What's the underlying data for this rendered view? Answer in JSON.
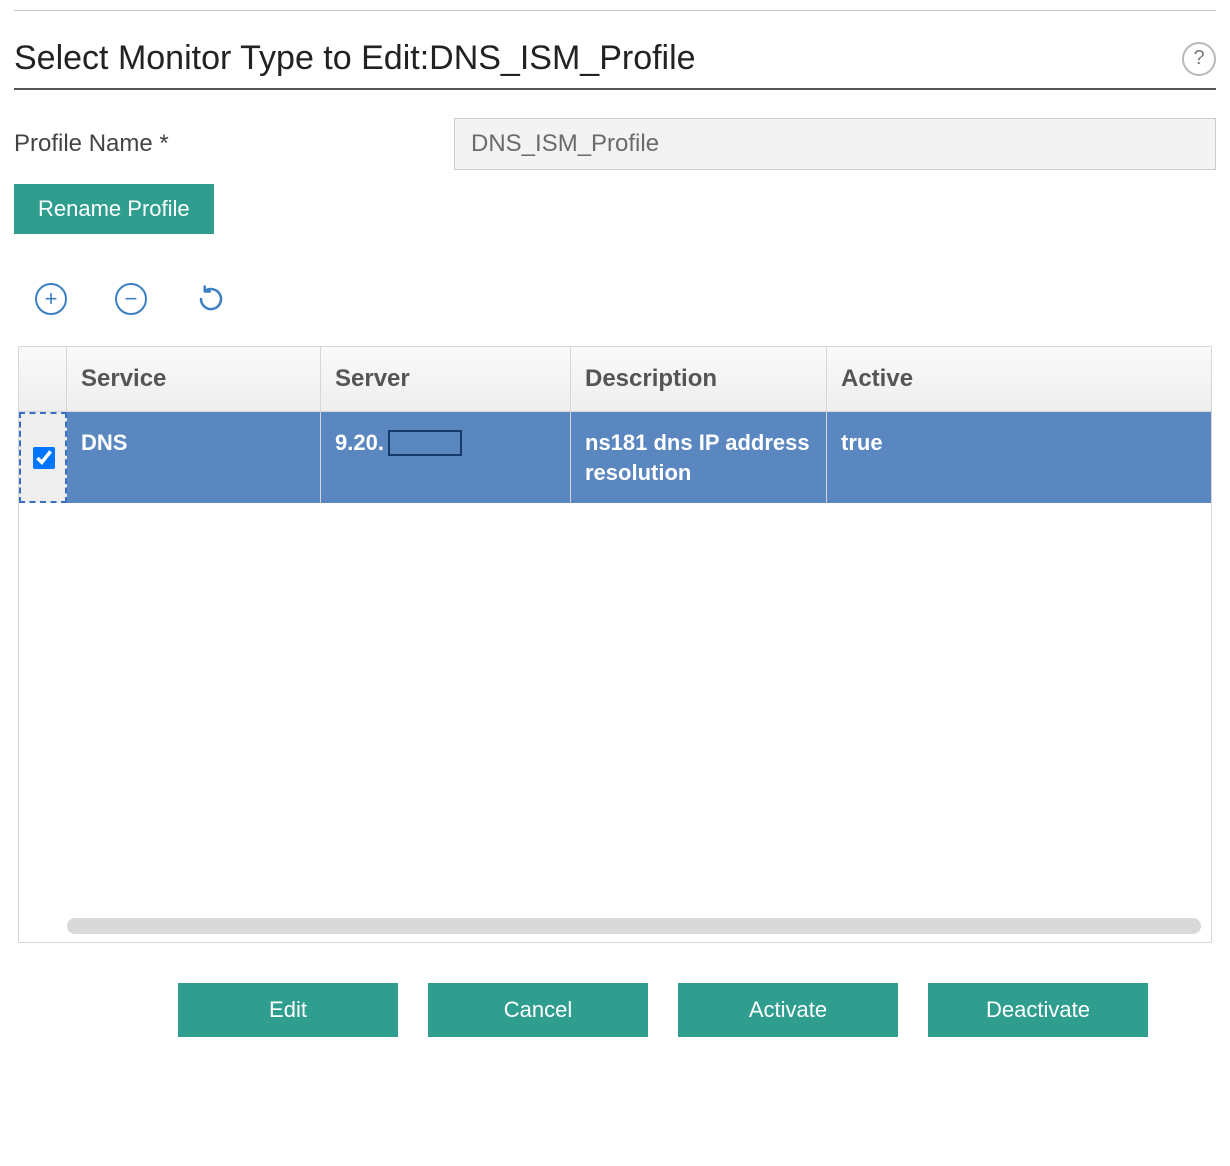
{
  "header": {
    "title": "Select Monitor Type to Edit:DNS_ISM_Profile",
    "help_tooltip": "?"
  },
  "form": {
    "profile_name_label": "Profile Name *",
    "profile_name_value": "DNS_ISM_Profile",
    "rename_button": "Rename Profile"
  },
  "toolbar": {
    "add_icon_name": "plus-icon",
    "remove_icon_name": "minus-icon",
    "refresh_icon_name": "refresh-icon"
  },
  "table": {
    "columns": {
      "service": "Service",
      "server": "Server",
      "description": "Description",
      "active": "Active"
    },
    "rows": [
      {
        "checked": true,
        "service": "DNS",
        "server_prefix": "9.20.",
        "server_redacted": true,
        "description": "ns181 dns IP address resolution",
        "active": "true"
      }
    ]
  },
  "actions": {
    "edit": "Edit",
    "cancel": "Cancel",
    "activate": "Activate",
    "deactivate": "Deactivate"
  },
  "colors": {
    "teal": "#2f9e8f",
    "row_selected": "#5a87bf",
    "icon_blue": "#3b7fc4"
  }
}
